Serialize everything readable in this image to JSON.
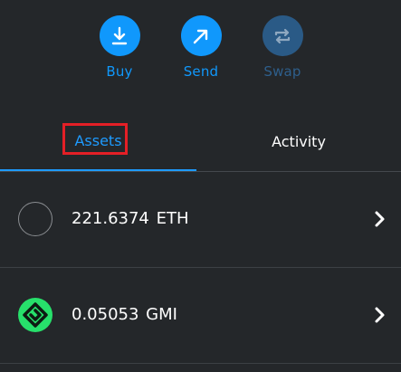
{
  "actions": {
    "buy": {
      "label": "Buy",
      "icon": "download-arrow-icon",
      "color": "#1098fc"
    },
    "send": {
      "label": "Send",
      "icon": "diagonal-arrow-icon",
      "color": "#1098fc"
    },
    "swap": {
      "label": "Swap",
      "icon": "swap-arrows-icon",
      "color": "#2e5f8c",
      "disabled": true
    }
  },
  "tabs": [
    {
      "label": "Assets",
      "active": true,
      "accent": "#1e9bff"
    },
    {
      "label": "Activity",
      "active": false
    }
  ],
  "highlight_color": "#e41f26",
  "assets": [
    {
      "amount": "221.6374",
      "symbol": "ETH",
      "icon": "empty-token-icon"
    },
    {
      "amount": "0.05053",
      "symbol": "GMI",
      "icon": "gmi-token-icon",
      "icon_color": "#27e06b"
    }
  ]
}
